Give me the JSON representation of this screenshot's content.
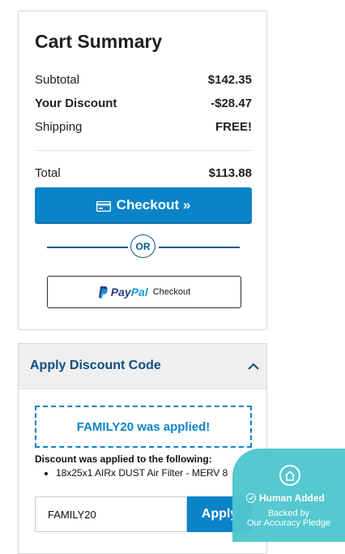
{
  "summary": {
    "title": "Cart Summary",
    "subtotal_label": "Subtotal",
    "subtotal_value": "$142.35",
    "discount_label": "Your Discount",
    "discount_value": "-$28.47",
    "shipping_label": "Shipping",
    "shipping_value": "FREE!",
    "total_label": "Total",
    "total_value": "$113.88",
    "checkout_label": "Checkout »",
    "or_label": "OR",
    "paypal": {
      "pay": "Pay",
      "pal": "Pal",
      "checkout": "Checkout"
    }
  },
  "discount": {
    "title": "Apply Discount Code",
    "applied_message": "FAMILY20 was applied!",
    "applied_to_heading": "Discount was applied to the following:",
    "applied_items": [
      "18x25x1 AIRx DUST Air Filter - MERV 8"
    ],
    "code_value": "FAMILY20",
    "apply_label": "Apply"
  },
  "badge": {
    "title": "Human Added",
    "line1": "Backed by",
    "line2": "Our Accuracy Pledge"
  },
  "colors": {
    "accent": "#0a83c9",
    "heading_blue": "#0b4f7c",
    "badge_teal": "#4fc6cf",
    "paypal_dark": "#253b80",
    "paypal_light": "#179bd7"
  },
  "icons": [
    "credit-card-icon",
    "paypal-icon",
    "chevron-up-icon",
    "home-icon",
    "check-circle-icon"
  ]
}
